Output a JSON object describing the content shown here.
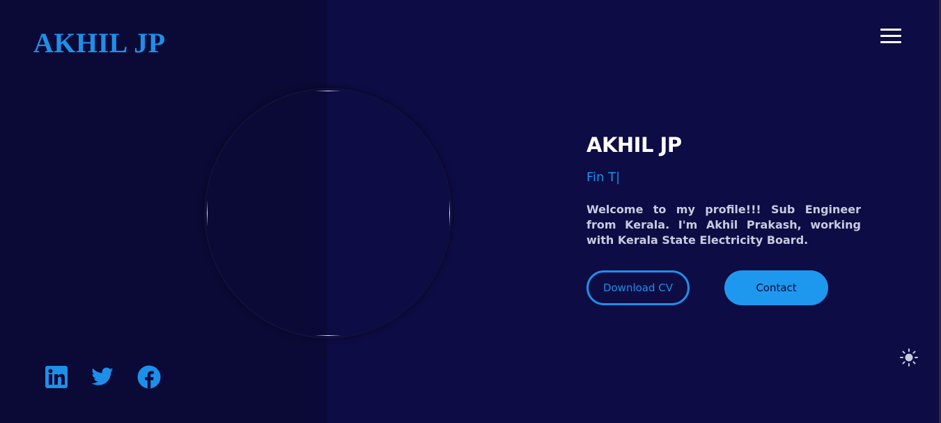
{
  "header": {
    "logo_text": "AKHIL JP",
    "menu_icon": "hamburger-menu-icon"
  },
  "hero": {
    "name": "AKHIL JP",
    "role_typing": "Fin T|",
    "description": "Welcome to my profile!!! Sub Engineer from Kerala. I'm Akhil Prakash, working with Kerala State Electricity Board.",
    "download_cv_label": "Download CV",
    "contact_label": "Contact"
  },
  "social": [
    {
      "name": "linkedin",
      "icon": "linkedin-icon"
    },
    {
      "name": "twitter",
      "icon": "twitter-icon"
    },
    {
      "name": "facebook",
      "icon": "facebook-icon"
    }
  ],
  "theme_toggle": {
    "icon": "sun-icon"
  },
  "colors": {
    "background": "#0e0c44",
    "left_panel": "#0b0a37",
    "accent": "#1e8fe8",
    "text_primary": "#ffffff",
    "text_secondary": "#c9cbe0"
  }
}
